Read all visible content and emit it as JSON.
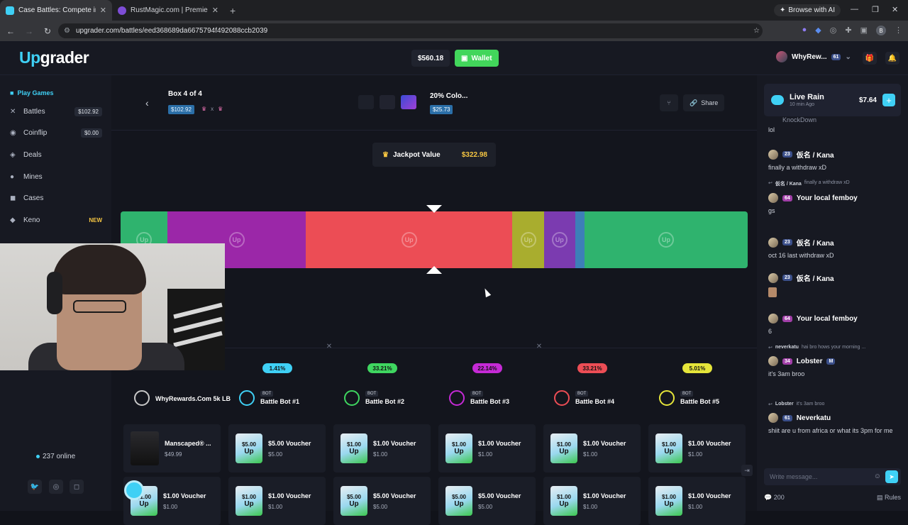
{
  "browser": {
    "tabs": [
      {
        "title": "Case Battles: Compete in Myst",
        "color": "#3fd0f5"
      },
      {
        "title": "RustMagic.com | Premiere Rust",
        "color": "#7d4dd6"
      }
    ],
    "browse_ai": "Browse with AI",
    "url": "upgrader.com/battles/eed368689da6675794f492088ccb2039",
    "profile_initial": "B"
  },
  "header": {
    "logo_up": "Up",
    "logo_rest": "grader",
    "balance": "$560.18",
    "wallet_label": "Wallet",
    "username": "WhyRew...",
    "user_level": "61"
  },
  "sidebar": {
    "heading": "Play Games",
    "items": [
      {
        "label": "Battles",
        "badge": "$102.92",
        "icon": "swords-icon"
      },
      {
        "label": "Coinflip",
        "badge": "$0.00",
        "icon": "coin-icon"
      },
      {
        "label": "Deals",
        "badge": "",
        "icon": "deals-icon"
      },
      {
        "label": "Mines",
        "badge": "",
        "icon": "mine-icon"
      },
      {
        "label": "Cases",
        "badge": "",
        "icon": "case-icon"
      },
      {
        "label": "Keno",
        "badge": "NEW",
        "icon": "keno-icon"
      }
    ],
    "online": "237 online"
  },
  "battle": {
    "box_title": "Box 4 of 4",
    "box_price": "$102.92",
    "multiplier": "x",
    "case_name": "20% Colo...",
    "case_price": "$25.73",
    "share_label": "Share",
    "jackpot_label": "Jackpot Value",
    "jackpot_value": "$322.98"
  },
  "spinner": {
    "segments": [
      {
        "color": "#2fb36e",
        "share": 0.075
      },
      {
        "color": "#9b27a8",
        "share": 0.22
      },
      {
        "color": "#ec4d55",
        "share": 0.33
      },
      {
        "color": "#a9ad2e",
        "share": 0.05
      },
      {
        "color": "#7b3bb0",
        "share": 0.05
      },
      {
        "color": "#3d7fb8",
        "share": 0.015
      },
      {
        "color": "#2fb36e",
        "share": 0.26
      }
    ]
  },
  "players": [
    {
      "name": "WhyRewards.Com 5k LB",
      "pct": "",
      "bot": false,
      "color": "#c8c8c8"
    },
    {
      "name": "Battle Bot #1",
      "pct": "1.41%",
      "bot": true,
      "color": "#3fd0f5"
    },
    {
      "name": "Battle Bot #2",
      "pct": "33.21%",
      "bot": true,
      "color": "#3fd660"
    },
    {
      "name": "Battle Bot #3",
      "pct": "22.14%",
      "bot": true,
      "color": "#c52ad6"
    },
    {
      "name": "Battle Bot #4",
      "pct": "33.21%",
      "bot": true,
      "color": "#ec4d55"
    },
    {
      "name": "Battle Bot #5",
      "pct": "5.01%",
      "bot": true,
      "color": "#e5e53a"
    }
  ],
  "bot_label": "BOT",
  "items_row1": [
    {
      "name": "Manscaped® ...",
      "price": "$49.99",
      "product": true
    },
    {
      "name": "$5.00 Voucher",
      "price": "$5.00",
      "amount": "$5.00"
    },
    {
      "name": "$1.00 Voucher",
      "price": "$1.00",
      "amount": "$1.00"
    },
    {
      "name": "$1.00 Voucher",
      "price": "$1.00",
      "amount": "$1.00"
    },
    {
      "name": "$1.00 Voucher",
      "price": "$1.00",
      "amount": "$1.00"
    },
    {
      "name": "$1.00 Voucher",
      "price": "$1.00",
      "amount": "$1.00"
    }
  ],
  "items_row2": [
    {
      "name": "$1.00 Voucher",
      "price": "$1.00",
      "amount": "$1.00"
    },
    {
      "name": "$1.00 Voucher",
      "price": "$1.00",
      "amount": "$1.00"
    },
    {
      "name": "$5.00 Voucher",
      "price": "$5.00",
      "amount": "$5.00"
    },
    {
      "name": "$5.00 Voucher",
      "price": "$5.00",
      "amount": "$5.00"
    },
    {
      "name": "$1.00 Voucher",
      "price": "$1.00",
      "amount": "$1.00"
    },
    {
      "name": "$1.00 Voucher",
      "price": "$1.00",
      "amount": "$1.00"
    }
  ],
  "voucher_mark": "Up",
  "chat": {
    "rain_title": "Live Rain",
    "rain_sub": "10 min Ago",
    "rain_amount": "$7.64",
    "top_partial_name": "KnockDown",
    "top_partial_text": "lol",
    "messages": [
      {
        "name": "仮名 / Kana",
        "level": "23",
        "text": "finally a withdraw xD",
        "reply_to": "",
        "reply_text": "",
        "lvl_color": "#3b4f8a"
      },
      {
        "name": "Your local femboy",
        "level": "64",
        "text": "gs",
        "reply_to": "仮名 / Kana",
        "reply_text": "finally a withdraw xD",
        "lvl_color": "#a13fa8"
      },
      {
        "name": "仮名 / Kana",
        "level": "23",
        "text": "oct 16 last withdraw xD",
        "reply_to": "",
        "reply_text": "",
        "lvl_color": "#3b4f8a"
      },
      {
        "name": "仮名 / Kana",
        "level": "23",
        "text": "",
        "reply_to": "",
        "reply_text": "",
        "lvl_color": "#3b4f8a"
      },
      {
        "name": "Your local femboy",
        "level": "64",
        "text": "6",
        "reply_to": "",
        "reply_text": "",
        "lvl_color": "#a13fa8"
      },
      {
        "name": "Lobster",
        "level": "34",
        "text": "it's 3am broo",
        "reply_to": "neverkatu",
        "reply_text": "hai bro hows your morning ...",
        "lvl_color": "#a13fa8",
        "tag": "M"
      },
      {
        "name": "Neverkatu",
        "level": "61",
        "text": "shiit are u from africa or what its 3pm for me",
        "reply_to": "Lobster",
        "reply_text": "it's 3am broo",
        "lvl_color": "#3b4f8a"
      }
    ],
    "input_placeholder": "Write message...",
    "count": "200",
    "rules": "Rules"
  }
}
